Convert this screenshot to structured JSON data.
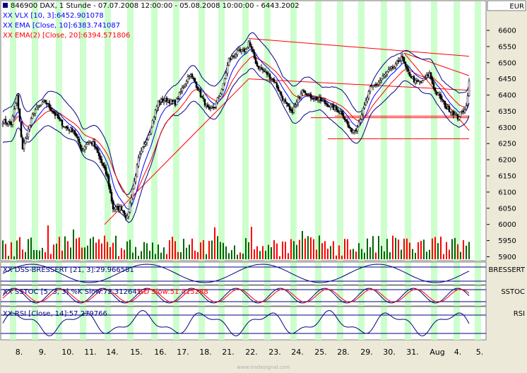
{
  "header": {
    "title_line": "846900  DAX, 1 Stunde - 07.07.2008 12:00:00 - 05.08.2008 10:00:00 - 6443.2002",
    "legend": [
      {
        "text": "XX VLX [10, 3]:6452.901078",
        "color": "#0000ff"
      },
      {
        "text": "XX EMA [Close, 10]:6383.741087",
        "color": "#0000ff"
      },
      {
        "text": "XX EMA(2) [Close, 20]:6394.571806",
        "color": "#ff0000"
      }
    ]
  },
  "price_axis": {
    "currency": "EUR",
    "ticks": [
      6600,
      6550,
      6500,
      6450,
      6400,
      6350,
      6300,
      6250,
      6200,
      6150,
      6100,
      6050,
      6000,
      5950,
      5900
    ]
  },
  "panels": {
    "dss": {
      "title": "XX DSS-BRESSERT [21, 3]:29.966581",
      "tag": "BRESSERT"
    },
    "stoc": {
      "title_k": "XX SSTOC [5, 3, 3] %K Slow:72.312641",
      "title_d": "%D Slow:51.415288",
      "tag": "SSTOC"
    },
    "rsi": {
      "title": "XX RSI [Close, 14]:57.279766",
      "tag": "RSI"
    }
  },
  "x_axis": {
    "labels": [
      "8.",
      "9.",
      "10.",
      "11.",
      "14.",
      "15.",
      "16.",
      "17.",
      "18.",
      "21.",
      "22.",
      "23.",
      "24.",
      "25.",
      "28.",
      "29.",
      "30.",
      "31.",
      "Aug",
      "4.",
      "5."
    ]
  },
  "footer": {
    "watermark": "www.tradesignal.com"
  },
  "colors": {
    "background": "#ffffff",
    "band": "#ccffcc",
    "bull": "#006600",
    "bear": "#ff0000",
    "ema10": "#0000ff",
    "ema20": "#ff0000",
    "vlx": "#000080",
    "trend": "#ff0000"
  },
  "chart_data": {
    "type": "candlestick",
    "ylim": [
      5880,
      6640
    ],
    "close_anchors": [
      [
        0,
        6320
      ],
      [
        6,
        6310
      ],
      [
        10,
        6395
      ],
      [
        14,
        6235
      ],
      [
        22,
        6350
      ],
      [
        30,
        6380
      ],
      [
        36,
        6345
      ],
      [
        44,
        6300
      ],
      [
        50,
        6290
      ],
      [
        56,
        6230
      ],
      [
        60,
        6255
      ],
      [
        64,
        6250
      ],
      [
        70,
        6190
      ],
      [
        74,
        6145
      ],
      [
        78,
        6050
      ],
      [
        84,
        6050
      ],
      [
        88,
        6020
      ],
      [
        92,
        6110
      ],
      [
        96,
        6200
      ],
      [
        104,
        6290
      ],
      [
        110,
        6380
      ],
      [
        116,
        6385
      ],
      [
        122,
        6375
      ],
      [
        126,
        6410
      ],
      [
        132,
        6465
      ],
      [
        136,
        6440
      ],
      [
        140,
        6400
      ],
      [
        146,
        6350
      ],
      [
        150,
        6365
      ],
      [
        156,
        6430
      ],
      [
        160,
        6510
      ],
      [
        166,
        6530
      ],
      [
        172,
        6540
      ],
      [
        174,
        6565
      ],
      [
        180,
        6490
      ],
      [
        186,
        6470
      ],
      [
        192,
        6445
      ],
      [
        198,
        6390
      ],
      [
        204,
        6345
      ],
      [
        208,
        6375
      ],
      [
        212,
        6420
      ],
      [
        218,
        6395
      ],
      [
        224,
        6385
      ],
      [
        230,
        6370
      ],
      [
        236,
        6355
      ],
      [
        240,
        6345
      ],
      [
        246,
        6290
      ],
      [
        250,
        6295
      ],
      [
        256,
        6365
      ],
      [
        260,
        6420
      ],
      [
        266,
        6440
      ],
      [
        272,
        6470
      ],
      [
        278,
        6490
      ],
      [
        282,
        6520
      ],
      [
        286,
        6475
      ],
      [
        292,
        6440
      ],
      [
        296,
        6440
      ],
      [
        302,
        6465
      ],
      [
        306,
        6410
      ],
      [
        310,
        6390
      ],
      [
        314,
        6360
      ],
      [
        318,
        6350
      ],
      [
        322,
        6330
      ],
      [
        328,
        6365
      ],
      [
        330,
        6443
      ]
    ],
    "ema10_last": 6383.741087,
    "ema20_last": 6394.571806,
    "vlx_last": 6452.901078,
    "dss_last": 29.966581,
    "stoch_k_last": 72.312641,
    "stoch_d_last": 51.415288,
    "rsi_last": 57.279766,
    "trendlines": [
      {
        "from": [
          72,
          6000
        ],
        "to": [
          174,
          6450
        ]
      },
      {
        "from": [
          174,
          6450
        ],
        "to": [
          330,
          6415
        ]
      },
      {
        "from": [
          174,
          6575
        ],
        "to": [
          330,
          6520
        ]
      },
      {
        "from": [
          235,
          6335
        ],
        "to": [
          330,
          6335
        ]
      },
      {
        "from": [
          218,
          6330
        ],
        "to": [
          330,
          6330
        ]
      },
      {
        "from": [
          230,
          6265
        ],
        "to": [
          330,
          6265
        ]
      },
      {
        "from": [
          284,
          6530
        ],
        "to": [
          330,
          6290
        ]
      },
      {
        "from": [
          284,
          6530
        ],
        "to": [
          330,
          6460
        ]
      }
    ]
  }
}
